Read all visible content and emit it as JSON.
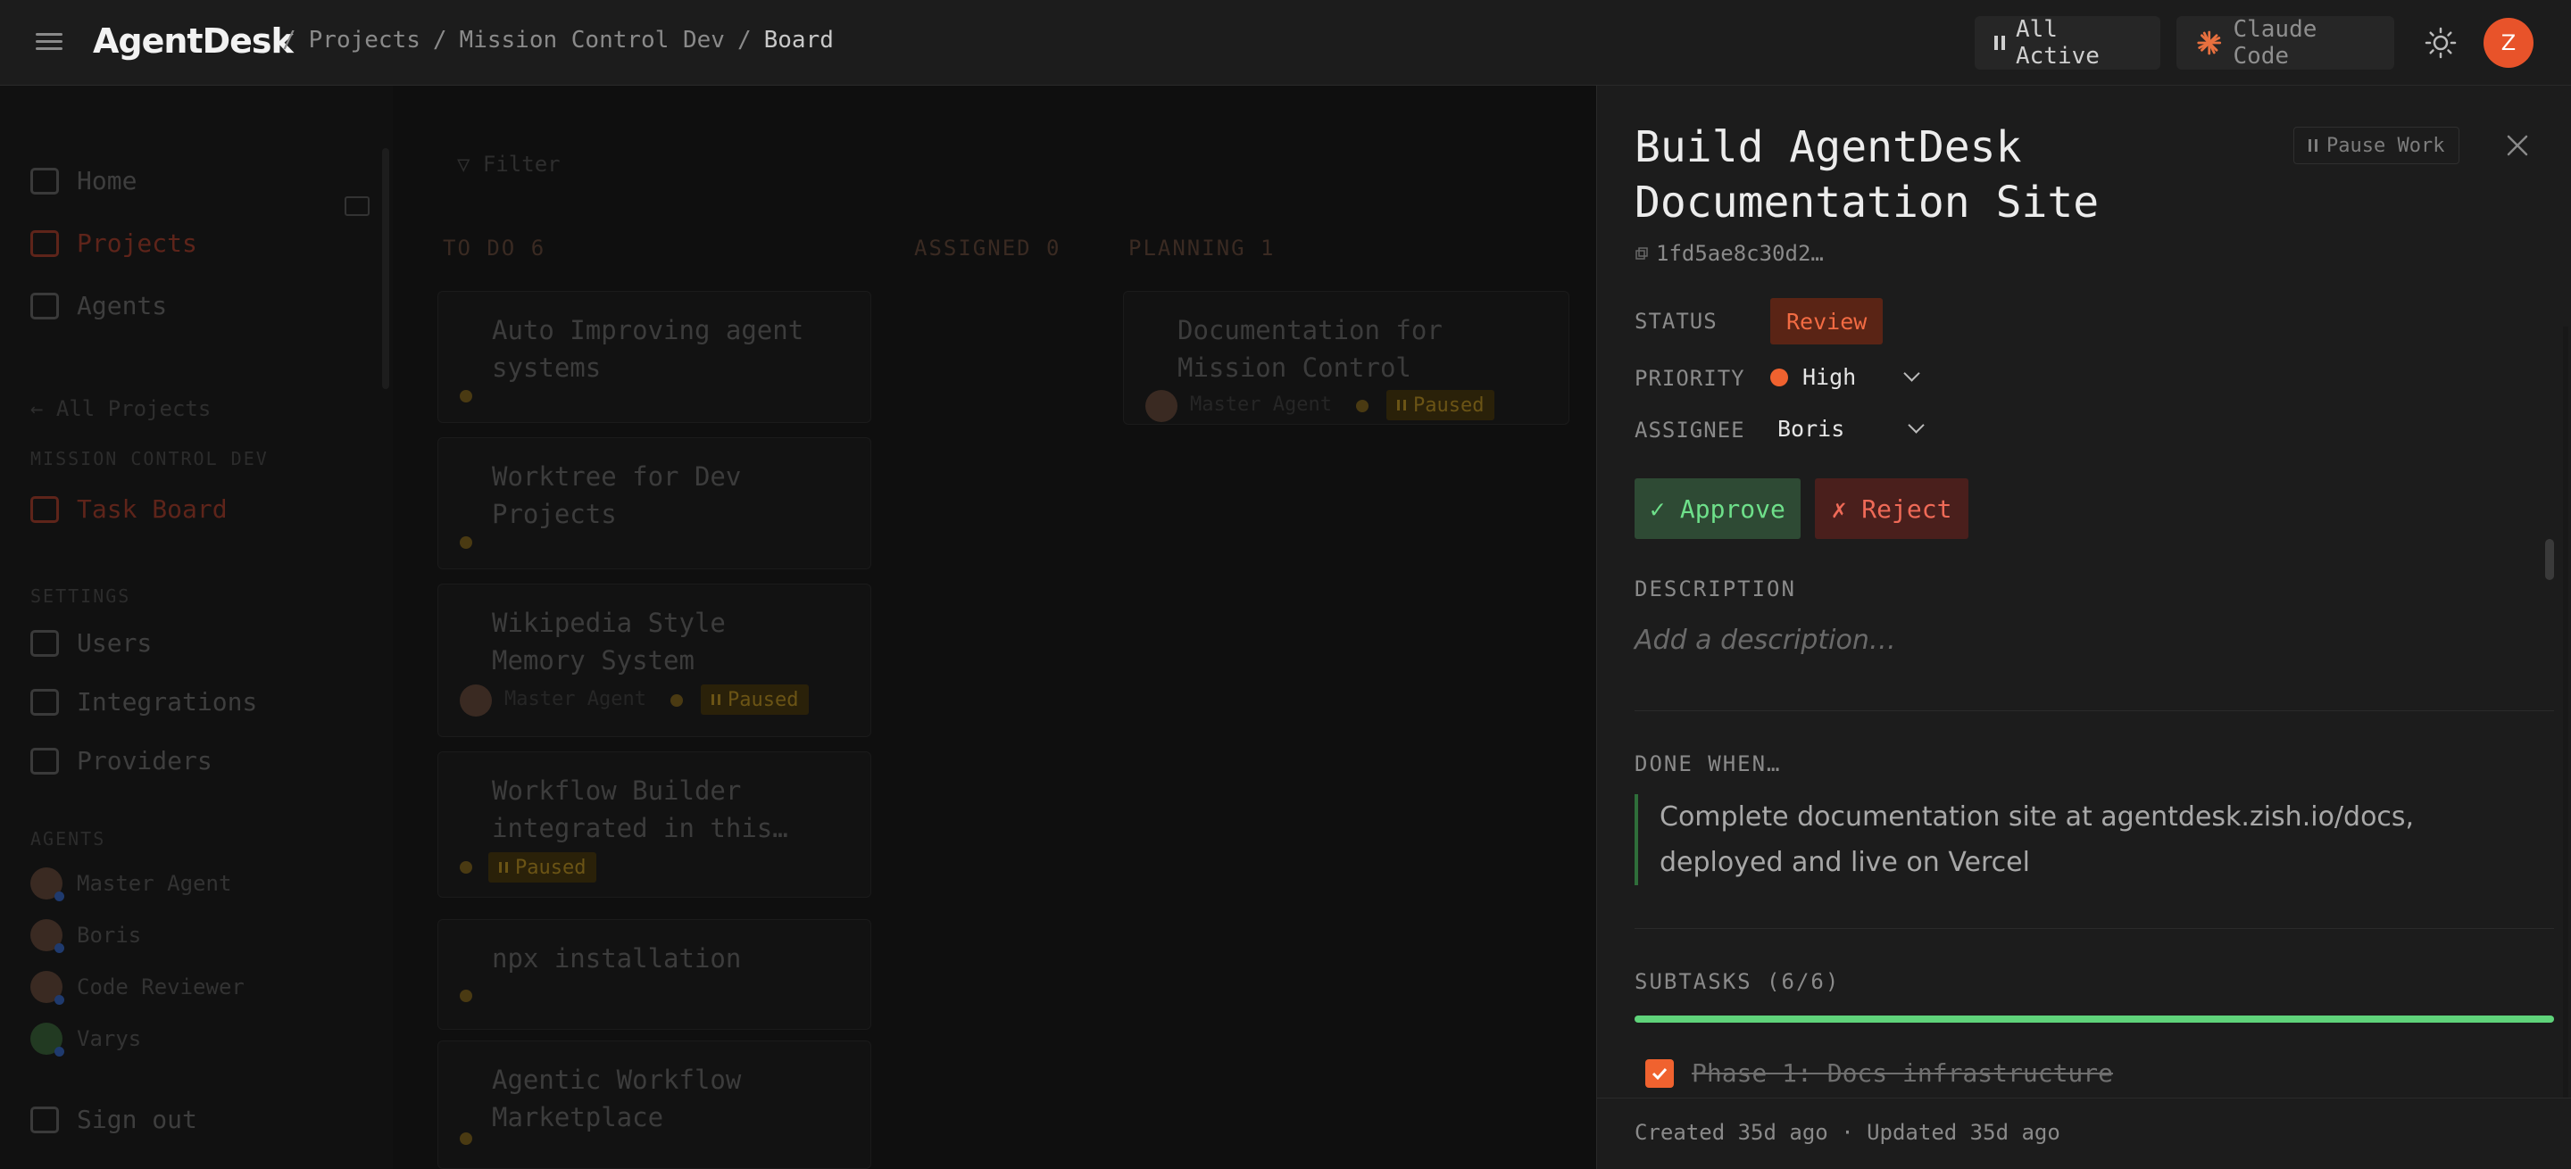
{
  "header": {
    "logo": "AgentDesk",
    "breadcrumbs": [
      "/",
      "Projects",
      "/",
      "Mission Control Dev",
      "/",
      "Board"
    ],
    "all_active": "All Active",
    "claude_code": "Claude Code",
    "user_initial": "Z"
  },
  "sidebar": {
    "items": [
      {
        "label": "Home",
        "icon": "home-icon"
      },
      {
        "label": "Projects",
        "icon": "folder-icon"
      },
      {
        "label": "Agents",
        "icon": "agent-icon"
      }
    ],
    "all_projects": "← All Projects",
    "section_project": "MISSION CONTROL DEV",
    "task_board": "Task Board",
    "section_settings": "SETTINGS",
    "settings_items": [
      {
        "label": "Users",
        "icon": "users-icon"
      },
      {
        "label": "Integrations",
        "icon": "plug-icon"
      },
      {
        "label": "Providers",
        "icon": "chip-icon"
      }
    ],
    "section_agents": "AGENTS",
    "agents": [
      "Master Agent",
      "Boris",
      "Code Reviewer",
      "Varys"
    ],
    "sign_out": "Sign out"
  },
  "board": {
    "filter": "Filter",
    "columns": [
      {
        "title": "TO DO",
        "count": "6"
      },
      {
        "title": "ASSIGNED",
        "count": "0"
      },
      {
        "title": "PLANNING",
        "count": "1"
      }
    ],
    "todo_cards": [
      {
        "title": "Auto Improving agent systems"
      },
      {
        "title": "Worktree for Dev Projects"
      },
      {
        "title": "Wikipedia Style Memory System",
        "agent": "Master Agent",
        "badge": "Paused"
      },
      {
        "title": "Workflow Builder integrated in this…",
        "badge": "Paused"
      },
      {
        "title": "npx installation"
      },
      {
        "title": "Agentic Workflow Marketplace"
      }
    ],
    "planning_cards": [
      {
        "title": "Documentation for Mission Control",
        "agent": "Master Agent",
        "badge": "Paused"
      }
    ]
  },
  "panel": {
    "title": "Build AgentDesk Documentation Site",
    "pause_work": "Pause Work",
    "id": "1fd5ae8c30d2…",
    "status_label": "STATUS",
    "status": "Review",
    "priority_label": "PRIORITY",
    "priority": "High",
    "assignee_label": "ASSIGNEE",
    "assignee": "Boris",
    "approve": "✓ Approve",
    "reject": "✗ Reject",
    "description_label": "DESCRIPTION",
    "description_placeholder": "Add a description…",
    "done_when_label": "DONE WHEN…",
    "done_when": "Complete documentation site at agentdesk.zish.io/docs, deployed and live on Vercel",
    "subtasks_label": "SUBTASKS (6/6)",
    "subtasks_progress": 1.0,
    "subtasks": [
      {
        "label": "Phase 1: Docs infrastructure",
        "done": true
      }
    ],
    "footer": "Created 35d ago · Updated 35d ago"
  }
}
